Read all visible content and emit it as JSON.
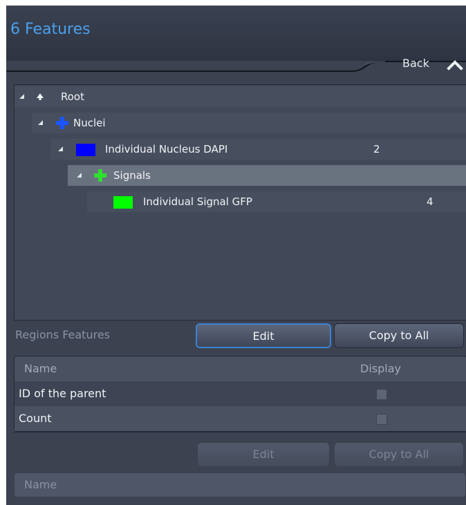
{
  "panel": {
    "title": "6  Features",
    "back_label": "Back"
  },
  "tree": [
    {
      "label": "Root",
      "value": ""
    },
    {
      "label": "Nuclei",
      "value": ""
    },
    {
      "label": "Individual Nucleus DAPI",
      "value": "2",
      "color": "#0000ff"
    },
    {
      "label": "Signals",
      "value": ""
    },
    {
      "label": "Individual Signal   GFP",
      "value": "4",
      "color": "#00ff00"
    }
  ],
  "regions": {
    "label": "Regions Features",
    "edit_label": "Edit",
    "copy_label": "Copy to All",
    "columns": [
      "Name",
      "Display"
    ],
    "rows": [
      {
        "name": "ID of the parent"
      },
      {
        "name": "Count"
      }
    ]
  },
  "lower": {
    "edit_label": "Edit",
    "copy_label": "Copy to All",
    "name_header": "Name"
  },
  "colors": {
    "accent": "#4aa0f0",
    "nuclei_plus": "#1a55ff",
    "signals_plus": "#2ee02e"
  }
}
